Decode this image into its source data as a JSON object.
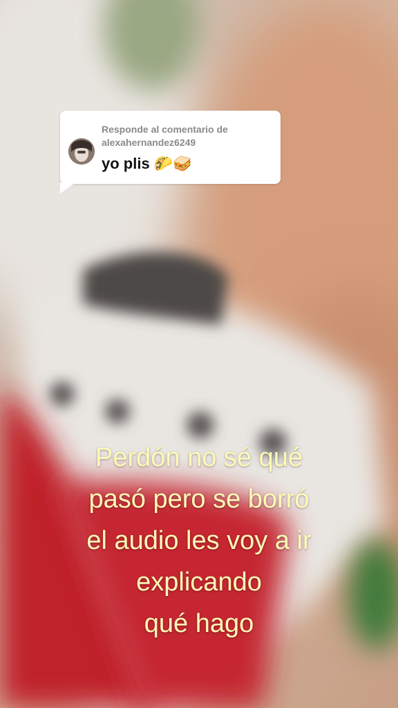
{
  "reply": {
    "header": "Responde al comentario de",
    "username": "alexahernandez6249",
    "comment": "yo plis 🌮🥪"
  },
  "caption": {
    "line1": "Perdón no sé qué",
    "line2": "pasó pero se borró",
    "line3": "el audio les voy a ir",
    "line4": "explicando",
    "line5": "qué hago"
  }
}
